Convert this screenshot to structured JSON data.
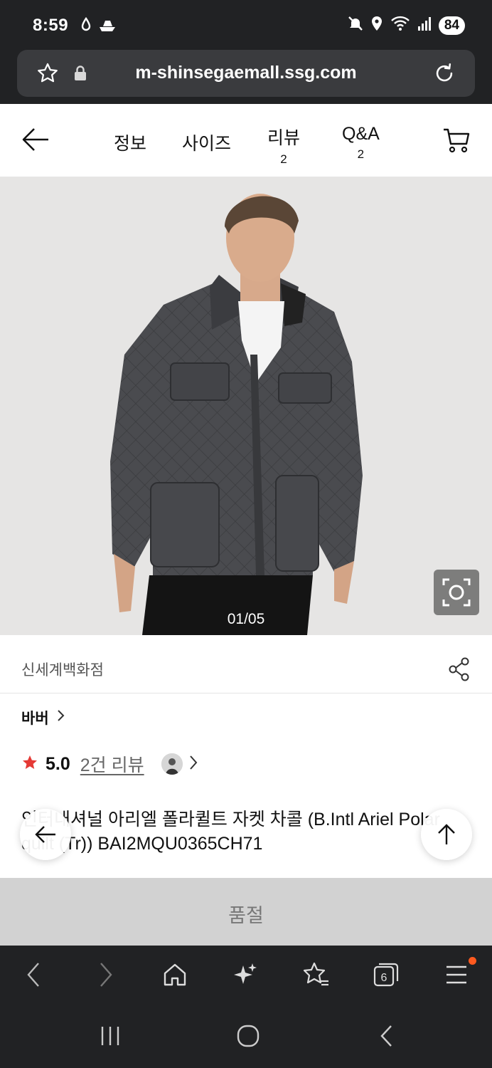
{
  "status_bar": {
    "time": "8:59",
    "battery": "84"
  },
  "browser": {
    "url": "m-shinsegaemall.ssg.com"
  },
  "header": {
    "tabs": [
      {
        "label": "정보",
        "count": ""
      },
      {
        "label": "사이즈",
        "count": ""
      },
      {
        "label": "리뷰",
        "count": "2"
      },
      {
        "label": "Q&A",
        "count": "2"
      }
    ]
  },
  "product": {
    "image_counter": "01/05",
    "store": "신세계백화점",
    "brand": "바버",
    "rating": "5.0",
    "review_link": "2건 리뷰",
    "title": "인터내셔널 아리엘 폴라퀼트 자켓 차콜 (B.Intl Ariel Polar quilt (Tr)) BAI2MQU0365CH71",
    "soldout_label": "품절"
  },
  "browser_toolbar": {
    "tabs_count": "6"
  },
  "colors": {
    "rating_star": "#e53935",
    "menu_dot": "#ff5a1f",
    "chrome": "#212224"
  }
}
